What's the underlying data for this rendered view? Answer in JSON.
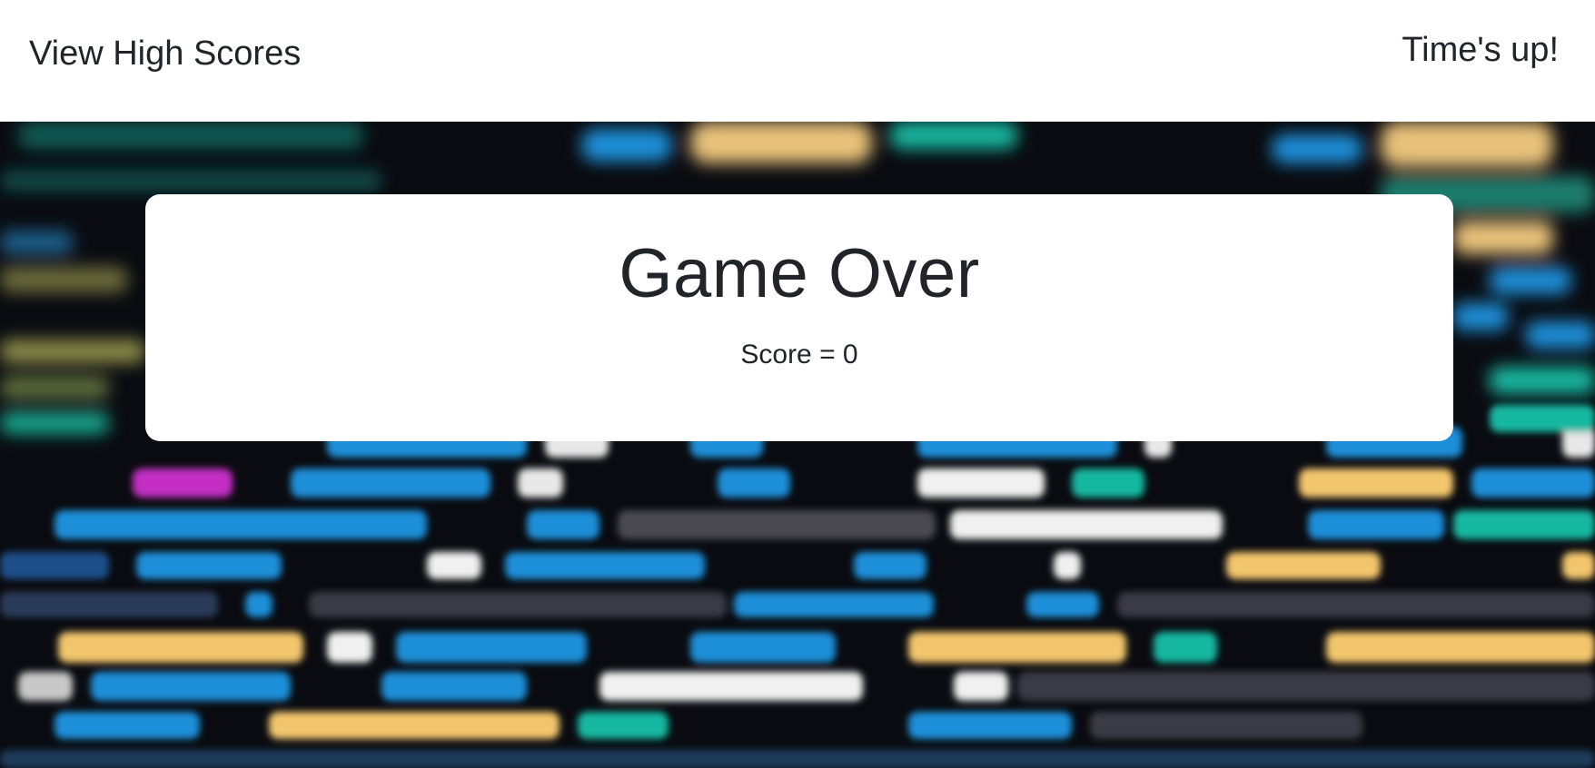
{
  "header": {
    "high_scores_label": "View High Scores",
    "timer_text": "Time's up!"
  },
  "result": {
    "title": "Game Over",
    "score_text": "Score = 0"
  },
  "background": {
    "description_icon": "blurred-code-background",
    "colors": {
      "blue": "#1a8fd8",
      "teal": "#18b7a0",
      "yellow": "#f2c66d",
      "white": "#f0f0f0",
      "magenta": "#c42fc4",
      "dark": "#0a0b10"
    }
  }
}
